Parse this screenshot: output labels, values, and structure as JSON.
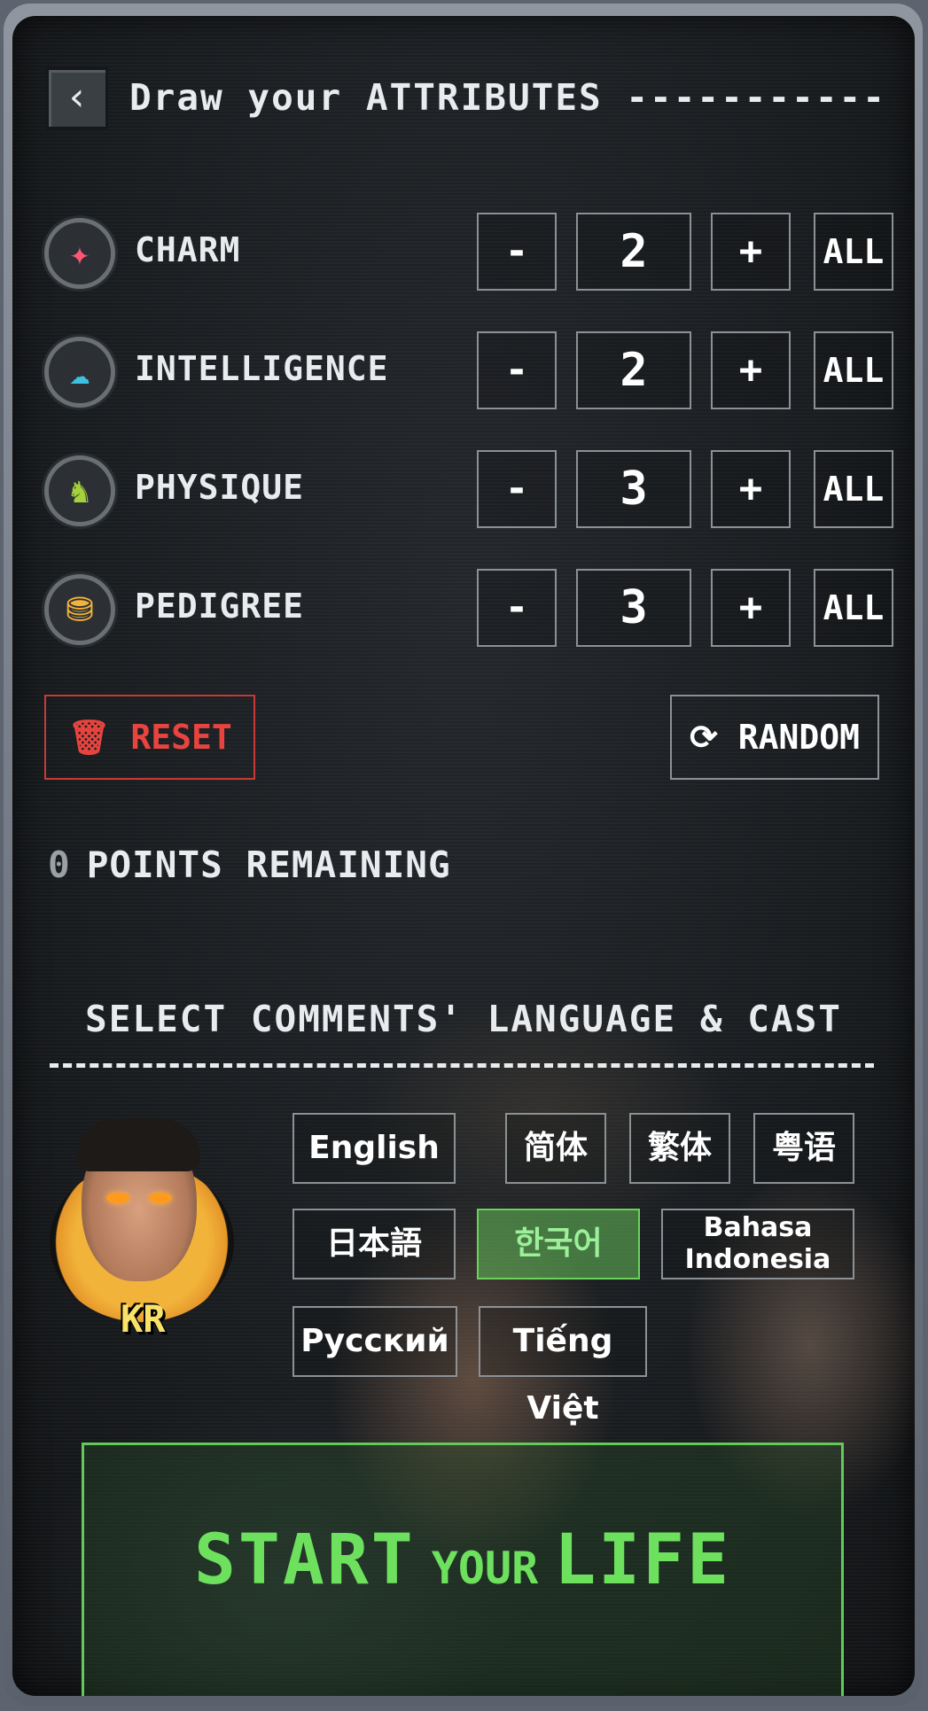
{
  "header": {
    "back_icon": "chevron-left-icon",
    "title": "Draw your ATTRIBUTES -----------"
  },
  "attributes": [
    {
      "label": "CHARM",
      "value": "2",
      "icon": "sparkles-icon",
      "icon_glyph": "✦",
      "icon_color": "#ff5577"
    },
    {
      "label": "INTELLIGENCE",
      "value": "2",
      "icon": "brain-icon",
      "icon_glyph": "☁",
      "icon_color": "#3fc0e0"
    },
    {
      "label": "PHYSIQUE",
      "value": "3",
      "icon": "flexed-bicep-icon",
      "icon_glyph": "♞",
      "icon_color": "#a4d23c"
    },
    {
      "label": "PEDIGREE",
      "value": "3",
      "icon": "coins-icon",
      "icon_glyph": "⛃",
      "icon_color": "#f2b33a"
    }
  ],
  "controls": {
    "minus": "-",
    "plus": "+",
    "all": "ALL"
  },
  "actions": {
    "reset_label": "RESET",
    "random_label": "RANDOM",
    "reset_color": "#e8443f"
  },
  "points": {
    "value": "0",
    "label": "POINTS REMAINING"
  },
  "language_section": {
    "title": "SELECT COMMENTS' LANGUAGE & CAST",
    "avatar_tag": "KR",
    "languages": [
      "English",
      "简体",
      "繁体",
      "粤语",
      "日本語",
      "한국어",
      "Bahasa Indonesia",
      "Русский",
      "Tiếng Việt"
    ],
    "selected": "한국어"
  },
  "start": {
    "word1": "START",
    "word2": "YOUR",
    "word3": "LIFE",
    "color": "#6de05e"
  }
}
